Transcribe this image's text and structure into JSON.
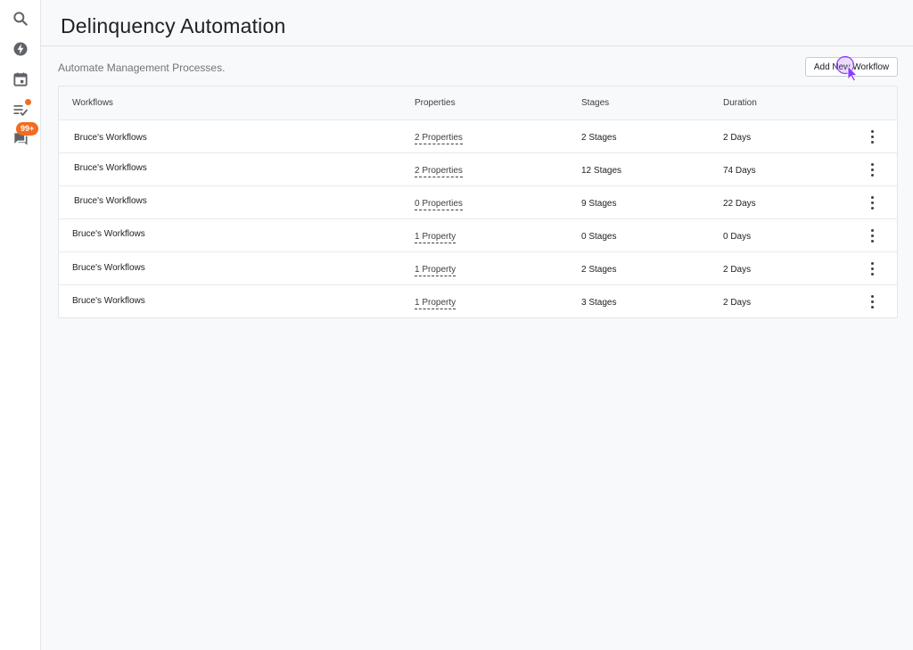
{
  "sidebar": {
    "icons": [
      {
        "name": "search-icon"
      },
      {
        "name": "bolt-icon"
      },
      {
        "name": "calendar-icon"
      },
      {
        "name": "checklist-icon"
      },
      {
        "name": "chat-icon"
      }
    ],
    "chat_badge": "99+"
  },
  "page": {
    "title": "Delinquency Automation",
    "subtitle": "Automate Management Processes.",
    "add_button": "Add New Workflow"
  },
  "table": {
    "headers": [
      "Workflows",
      "Properties",
      "Stages",
      "Duration"
    ],
    "rows": [
      {
        "workflow": "Bruce's Workflows",
        "properties": "2 Properties",
        "stages": "2 Stages",
        "duration": "2 Days"
      },
      {
        "workflow": "Bruce's Workflows",
        "properties": "2 Properties",
        "stages": "12 Stages",
        "duration": "74 Days"
      },
      {
        "workflow": "Bruce's Workflows",
        "properties": "0 Properties",
        "stages": "9 Stages",
        "duration": "22 Days"
      },
      {
        "workflow": "Bruce's Workflows",
        "properties": "1 Property",
        "stages": "0 Stages",
        "duration": "0 Days"
      },
      {
        "workflow": "Bruce's Workflows",
        "properties": "1 Property",
        "stages": "2 Stages",
        "duration": "2 Days"
      },
      {
        "workflow": "Bruce's Workflows",
        "properties": "1 Property",
        "stages": "3 Stages",
        "duration": "2 Days"
      }
    ]
  },
  "colors": {
    "accent": "#f26b21",
    "cursor": "#8b3dff"
  }
}
